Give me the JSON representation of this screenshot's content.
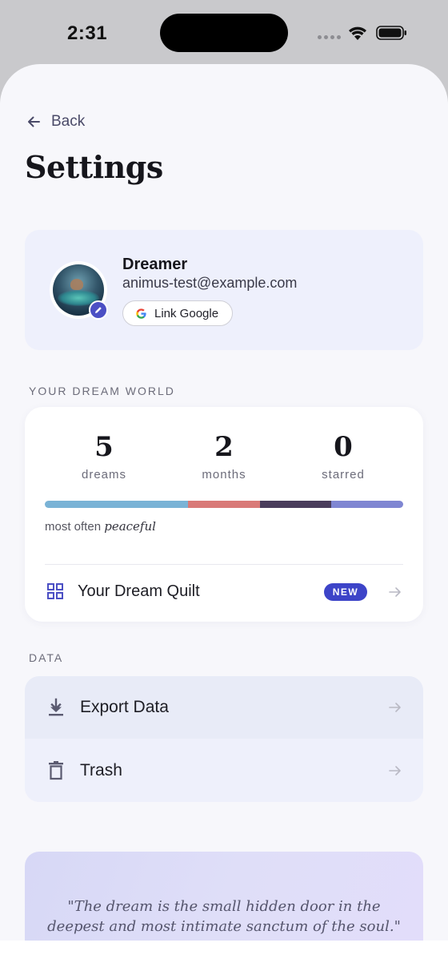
{
  "status_bar": {
    "time": "2:31"
  },
  "nav": {
    "back_label": "Back"
  },
  "page": {
    "title": "Settings"
  },
  "profile": {
    "name": "Dreamer",
    "email": "animus-test@example.com",
    "link_google_label": "Link Google"
  },
  "dream_world": {
    "section_label": "YOUR DREAM WORLD",
    "stats": [
      {
        "value": "5",
        "label": "dreams"
      },
      {
        "value": "2",
        "label": "months"
      },
      {
        "value": "0",
        "label": "starred"
      }
    ],
    "mood_segments": [
      {
        "color": "#7ab3d6",
        "fraction": 0.4
      },
      {
        "color": "#d97a78",
        "fraction": 0.2
      },
      {
        "color": "#4a3d5c",
        "fraction": 0.2
      },
      {
        "color": "#7f86d2",
        "fraction": 0.2
      }
    ],
    "mood_prefix": "most often",
    "mood_word": "peaceful",
    "quilt_label": "Your Dream Quilt",
    "quilt_badge": "NEW"
  },
  "data_section": {
    "section_label": "DATA",
    "items": [
      {
        "label": "Export Data",
        "icon": "download-icon"
      },
      {
        "label": "Trash",
        "icon": "trash-icon"
      }
    ]
  },
  "quote": {
    "text": "\"The dream is the small hidden door in the deepest and most intimate sanctum of the soul.\""
  },
  "colors": {
    "accent": "#3d44c8",
    "profile_card_bg": "#eef0fc",
    "page_bg": "#f7f7fb"
  }
}
